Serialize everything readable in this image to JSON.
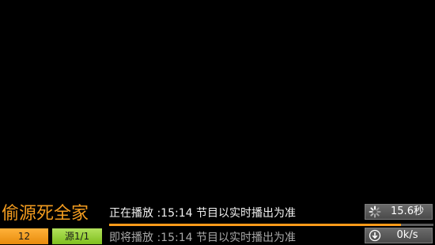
{
  "channel": {
    "name": "偷源死全家",
    "number": "12",
    "source": "源1/1"
  },
  "program": {
    "now": "正在播放 :15:14 节目以实时播出为准",
    "next": "即将播放 :15:14 节目以实时播出为准",
    "progress": 0.9
  },
  "status": {
    "time": "15.6秒",
    "speed": "0k/s",
    "time_icon": "loading-spinner-icon",
    "speed_icon": "download-icon"
  },
  "colors": {
    "channel_name": "#f39c1f",
    "number_bg": "#f7a42a",
    "source_bg": "#9ed240",
    "progress": "#ff9b1a"
  }
}
